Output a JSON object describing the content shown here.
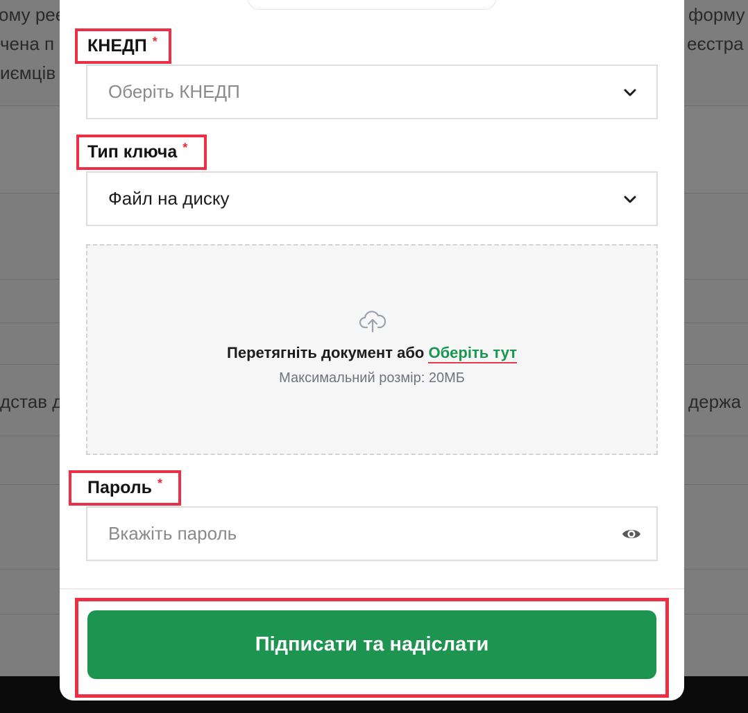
{
  "background": {
    "left_lines": [
      "ому рее",
      "чена п",
      "иємців",
      "дстав д"
    ],
    "right_lines": [
      "форму",
      "еєстра",
      "держа"
    ]
  },
  "form": {
    "kep_label": "КНЕДП",
    "kep_required": "*",
    "kep_placeholder": "Оберіть КНЕДП",
    "key_type_label": "Тип ключа",
    "key_type_required": "*",
    "key_type_value": "Файл на диску",
    "upload": {
      "prompt": "Перетягніть документ або",
      "link": "Оберіть тут",
      "hint": "Максимальний розмір: 20МБ"
    },
    "password_label": "Пароль",
    "password_required": "*",
    "password_placeholder": "Вкажіть пароль",
    "submit_label": "Підписати та надіслати"
  },
  "icons": {
    "select_chevron": "chevron-down-icon",
    "upload": "cloud-upload-icon",
    "password_toggle": "eye-icon"
  },
  "colors": {
    "primary": "#1d9450",
    "link": "#1a9651",
    "required": "#e0303a",
    "highlight": "#ec2f45"
  }
}
